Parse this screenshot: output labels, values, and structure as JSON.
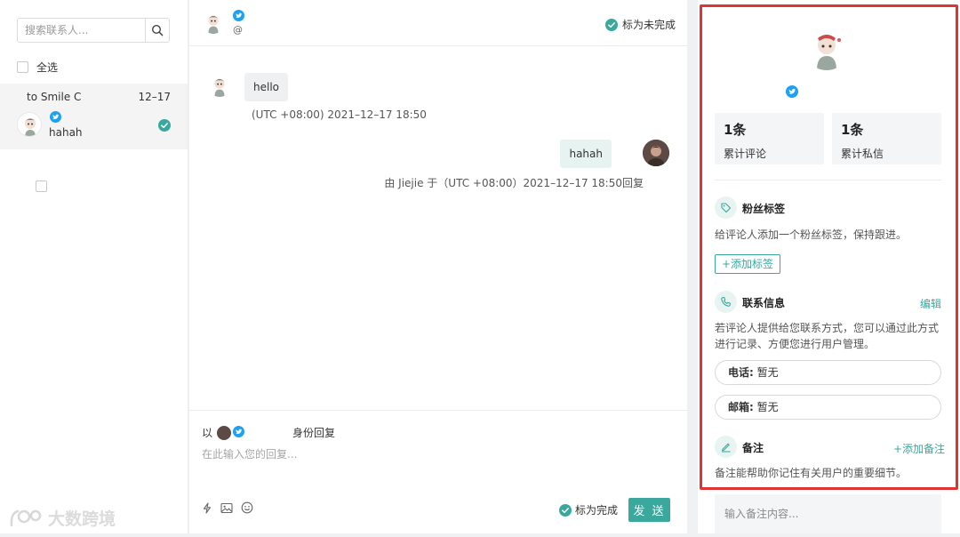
{
  "contacts": {
    "search_placeholder": "搜索联系人...",
    "select_all_label": "全选",
    "items": [
      {
        "name": "to Smile C",
        "date": "12–17",
        "last_message": "hahah",
        "platform_icon": "twitter-icon",
        "status_icon": "check-circle-icon"
      }
    ]
  },
  "chat": {
    "header": {
      "handle": "@",
      "platform_icon": "twitter-icon",
      "mark_undone_label": "标为未完成"
    },
    "messages": [
      {
        "direction": "incoming",
        "text": "hello",
        "timestamp": "(UTC +08:00)  2021–12–17 18:50"
      },
      {
        "direction": "outgoing",
        "text": "hahah",
        "timestamp_prefix": "由 ",
        "sender": "Jiejie",
        "timestamp_suffix": " 于（UTC +08:00）2021–12–17 18:50回复"
      }
    ],
    "composer": {
      "reply_as_prefix": "以",
      "reply_as_suffix": "身份回复",
      "placeholder": "在此输入您的回复...",
      "tool_icons": [
        "lightning-icon",
        "image-icon",
        "emoji-icon"
      ],
      "mark_done_label": "标为完成",
      "send_label": "发 送"
    }
  },
  "profile": {
    "platform_icon": "twitter-icon",
    "stats": [
      {
        "value": "1条",
        "label": "累计评论"
      },
      {
        "value": "1条",
        "label": "累计私信"
      }
    ],
    "fan_tags": {
      "title": "粉丝标签",
      "description": "给评论人添加一个粉丝标签，保持跟进。",
      "add_label": "+添加标签"
    },
    "contact_info": {
      "title": "联系信息",
      "edit_label": "编辑",
      "description": "若评论人提供给您联系方式，您可以通过此方式进行记录、方便您进行用户管理。",
      "phone_label": "电话:",
      "phone_value": "暂无",
      "email_label": "邮箱:",
      "email_value": "暂无"
    },
    "notes": {
      "title": "备注",
      "add_label": "+添加备注",
      "description": "备注能帮助你记住有关用户的重要细节。",
      "input_placeholder": "输入备注内容..."
    }
  },
  "watermark": {
    "text": "大数跨境"
  },
  "colors": {
    "accent": "#3aa89c",
    "twitter": "#1da1f2",
    "highlight": "#e03333"
  }
}
